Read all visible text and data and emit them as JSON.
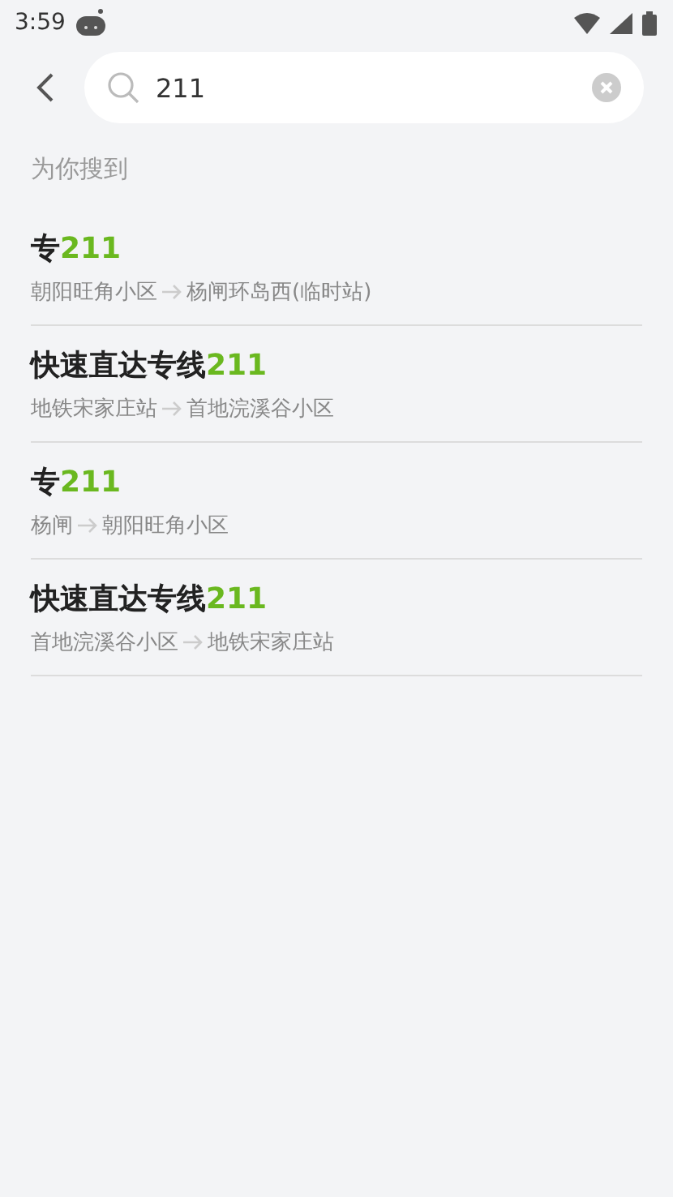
{
  "status_bar": {
    "time": "3:59"
  },
  "search": {
    "value": "211"
  },
  "section_title": "为你搜到",
  "results": [
    {
      "name": "专",
      "match": "211",
      "from": "朝阳旺角小区",
      "to": "杨闸环岛西(临时站)"
    },
    {
      "name": "快速直达专线",
      "match": "211",
      "from": "地铁宋家庄站",
      "to": "首地浣溪谷小区"
    },
    {
      "name": "专",
      "match": "211",
      "from": "杨闸",
      "to": "朝阳旺角小区"
    },
    {
      "name": "快速直达专线",
      "match": "211",
      "from": "首地浣溪谷小区",
      "to": "地铁宋家庄站"
    }
  ]
}
